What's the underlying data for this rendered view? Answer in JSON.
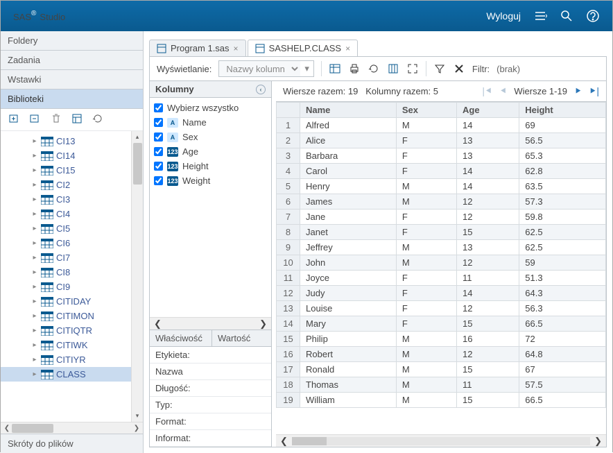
{
  "app_title": "SAS",
  "app_sub": "Studio",
  "header": {
    "logout": "Wyloguj"
  },
  "nav": {
    "folders": "Foldery",
    "tasks": "Zadania",
    "snippets": "Wstawki",
    "libs": "Biblioteki",
    "shortcuts": "Skróty do plików"
  },
  "tree": [
    {
      "label": "CI13"
    },
    {
      "label": "CI14"
    },
    {
      "label": "CI15"
    },
    {
      "label": "CI2"
    },
    {
      "label": "CI3"
    },
    {
      "label": "CI4"
    },
    {
      "label": "CI5"
    },
    {
      "label": "CI6"
    },
    {
      "label": "CI7"
    },
    {
      "label": "CI8"
    },
    {
      "label": "CI9"
    },
    {
      "label": "CITIDAY"
    },
    {
      "label": "CITIMON"
    },
    {
      "label": "CITIQTR"
    },
    {
      "label": "CITIWK"
    },
    {
      "label": "CITIYR"
    },
    {
      "label": "CLASS",
      "sel": true
    }
  ],
  "tabs": [
    {
      "label": "Program 1.sas"
    },
    {
      "label": "SASHELP.CLASS",
      "active": true
    }
  ],
  "view": {
    "label": "Wyświetlanie:",
    "placeholder": "Nazwy kolumn",
    "filter_label": "Filtr:",
    "filter_value": "(brak)"
  },
  "cols": {
    "title": "Kolumny",
    "select_all": "Wybierz wszystko",
    "items": [
      {
        "label": "Name",
        "type": "ch"
      },
      {
        "label": "Sex",
        "type": "ch"
      },
      {
        "label": "Age",
        "type": "nm"
      },
      {
        "label": "Height",
        "type": "nm"
      },
      {
        "label": "Weight",
        "type": "nm"
      }
    ]
  },
  "props": {
    "h1": "Właściwość",
    "h2": "Wartość",
    "rows": [
      [
        "Etykieta:",
        ""
      ],
      [
        "Nazwa",
        ""
      ],
      [
        "Długość:",
        ""
      ],
      [
        "Typ:",
        ""
      ],
      [
        "Format:",
        ""
      ],
      [
        "Informat:",
        ""
      ]
    ]
  },
  "grid": {
    "row_total_lbl": "Wiersze razem:",
    "row_total": "19",
    "col_total_lbl": "Kolumny razem:",
    "col_total": "5",
    "range_lbl": "Wiersze 1-19",
    "headers": [
      "Name",
      "Sex",
      "Age",
      "Height"
    ],
    "rows": [
      [
        "Alfred",
        "M",
        "14",
        "69"
      ],
      [
        "Alice",
        "F",
        "13",
        "56.5"
      ],
      [
        "Barbara",
        "F",
        "13",
        "65.3"
      ],
      [
        "Carol",
        "F",
        "14",
        "62.8"
      ],
      [
        "Henry",
        "M",
        "14",
        "63.5"
      ],
      [
        "James",
        "M",
        "12",
        "57.3"
      ],
      [
        "Jane",
        "F",
        "12",
        "59.8"
      ],
      [
        "Janet",
        "F",
        "15",
        "62.5"
      ],
      [
        "Jeffrey",
        "M",
        "13",
        "62.5"
      ],
      [
        "John",
        "M",
        "12",
        "59"
      ],
      [
        "Joyce",
        "F",
        "11",
        "51.3"
      ],
      [
        "Judy",
        "F",
        "14",
        "64.3"
      ],
      [
        "Louise",
        "F",
        "12",
        "56.3"
      ],
      [
        "Mary",
        "F",
        "15",
        "66.5"
      ],
      [
        "Philip",
        "M",
        "16",
        "72"
      ],
      [
        "Robert",
        "M",
        "12",
        "64.8"
      ],
      [
        "Ronald",
        "M",
        "15",
        "67"
      ],
      [
        "Thomas",
        "M",
        "11",
        "57.5"
      ],
      [
        "William",
        "M",
        "15",
        "66.5"
      ]
    ]
  }
}
